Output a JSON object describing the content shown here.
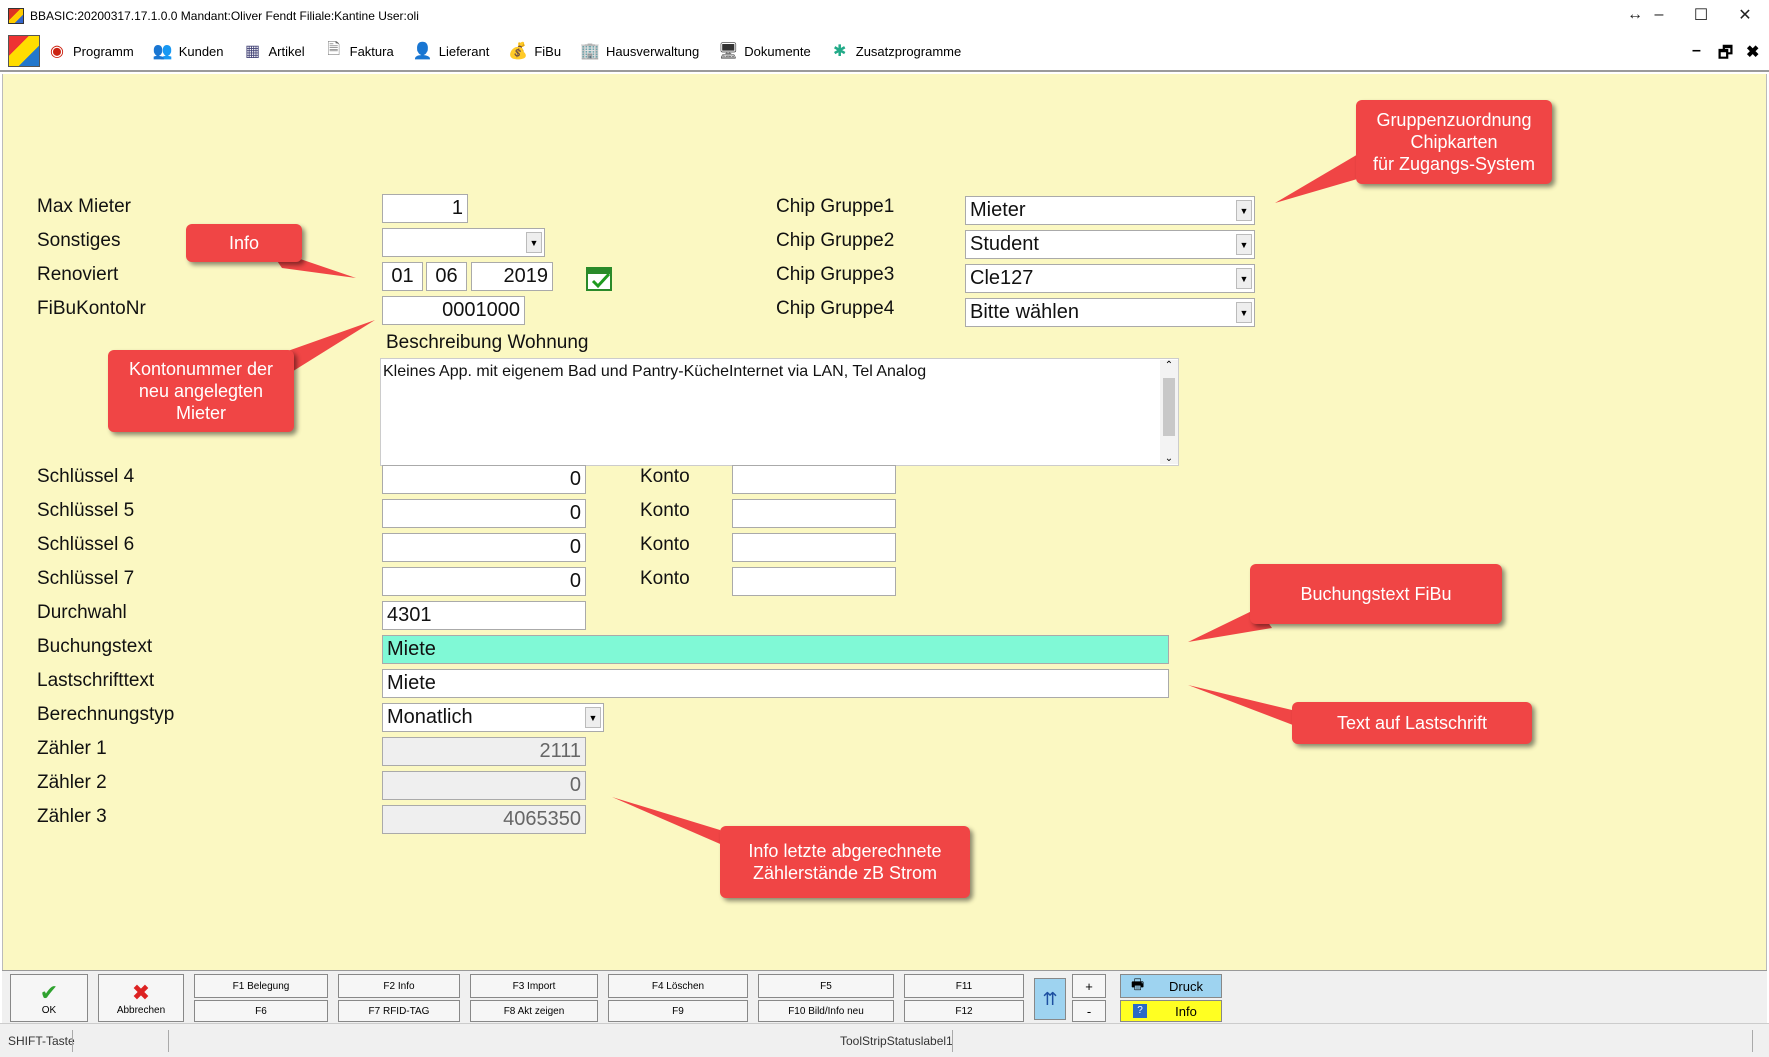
{
  "window": {
    "title": "BBASIC:20200317.17.1.0.0 Mandant:Oliver Fendt Filiale:Kantine User:oli",
    "restore_glyph": "↔",
    "minimize": "–",
    "maximize": "☐",
    "close": "✕"
  },
  "menu": {
    "items": [
      {
        "label": "Programm",
        "icon": "programm-icon",
        "glyph": "◉"
      },
      {
        "label": "Kunden",
        "icon": "kunden-icon",
        "glyph": "👥"
      },
      {
        "label": "Artikel",
        "icon": "artikel-icon",
        "glyph": "▦"
      },
      {
        "label": "Faktura",
        "icon": "faktura-icon",
        "glyph": "🗎"
      },
      {
        "label": "Lieferant",
        "icon": "lieferant-icon",
        "glyph": "👤"
      },
      {
        "label": "FiBu",
        "icon": "fibu-icon",
        "glyph": "💰"
      },
      {
        "label": "Hausverwaltung",
        "icon": "hausverwaltung-icon",
        "glyph": "🏢"
      },
      {
        "label": "Dokumente",
        "icon": "dokumente-icon",
        "glyph": "🖥"
      },
      {
        "label": "Zusatzprogramme",
        "icon": "zusatzprogramme-icon",
        "glyph": "✱"
      }
    ],
    "mdi_minimize": "–",
    "mdi_restore": "🗗",
    "mdi_close": "✖"
  },
  "form": {
    "max_mieter": {
      "label": "Max Mieter",
      "value": "1"
    },
    "sonstiges": {
      "label": "Sonstiges",
      "value": ""
    },
    "renoviert": {
      "label": "Renoviert",
      "day": "01",
      "month": "06",
      "year": "2019"
    },
    "fibu_konto": {
      "label": "FiBuKontoNr",
      "value": "0001000"
    },
    "beschreibung": {
      "label": "Beschreibung Wohnung",
      "value": "Kleines App. mit eigenem Bad und Pantry-KücheInternet via LAN, Tel Analog"
    },
    "chip_gruppen": [
      {
        "label": "Chip Gruppe1",
        "value": "Mieter"
      },
      {
        "label": "Chip Gruppe2",
        "value": "Student"
      },
      {
        "label": "Chip Gruppe3",
        "value": "Cle127"
      },
      {
        "label": "Chip Gruppe4",
        "value": "Bitte wählen"
      }
    ],
    "schluessel": [
      {
        "label": "Schlüssel 4",
        "value": "0",
        "konto_label": "Konto",
        "konto": ""
      },
      {
        "label": "Schlüssel 5",
        "value": "0",
        "konto_label": "Konto",
        "konto": ""
      },
      {
        "label": "Schlüssel 6",
        "value": "0",
        "konto_label": "Konto",
        "konto": ""
      },
      {
        "label": "Schlüssel 7",
        "value": "0",
        "konto_label": "Konto",
        "konto": ""
      }
    ],
    "durchwahl": {
      "label": "Durchwahl",
      "value": "4301"
    },
    "buchungstext": {
      "label": "Buchungstext",
      "value": "Miete"
    },
    "lastschrifttext": {
      "label": "Lastschrifttext",
      "value": "Miete"
    },
    "berechnungstyp": {
      "label": "Berechnungstyp",
      "value": "Monatlich"
    },
    "zaehler": [
      {
        "label": "Zähler 1",
        "value": "2111"
      },
      {
        "label": "Zähler 2",
        "value": "0"
      },
      {
        "label": "Zähler 3",
        "value": "4065350"
      }
    ]
  },
  "callouts": {
    "gruppen": "Gruppenzuordnung\nChipkarten\nfür Zugangs-System",
    "info": "Info",
    "kontonummer": "Kontonummer der\nneu angelegten\nMieter",
    "buchungstext": "Buchungstext FiBu",
    "lastschrift": "Text auf Lastschrift",
    "zaehler": "Info letzte abgerechnete\nZählerstände zB Strom"
  },
  "toolbar": {
    "ok": "OK",
    "ok_glyph": "✔",
    "abbrechen": "Abbrechen",
    "abbrechen_glyph": "✖",
    "top": [
      "F1 Belegung",
      "F2 Info",
      "F3 Import",
      "F4 Löschen",
      "F5",
      "F11"
    ],
    "bottom": [
      "F6",
      "F7 RFID-TAG",
      "F8 Akt zeigen",
      "F9",
      "F10 Bild/Info neu",
      "F12"
    ],
    "up_glyph": "⇈",
    "plus": "+",
    "minus": "-",
    "druck": "Druck",
    "info": "Info"
  },
  "status": {
    "shift": "SHIFT-Taste",
    "label": "ToolStripStatuslabel1"
  },
  "colors": {
    "panel_bg": "#fbf8c2",
    "callout": "#f04545",
    "buchungstext_bg": "#80f9d6",
    "druck_bg": "#9ed3f0",
    "info_bg": "#ffff22"
  }
}
